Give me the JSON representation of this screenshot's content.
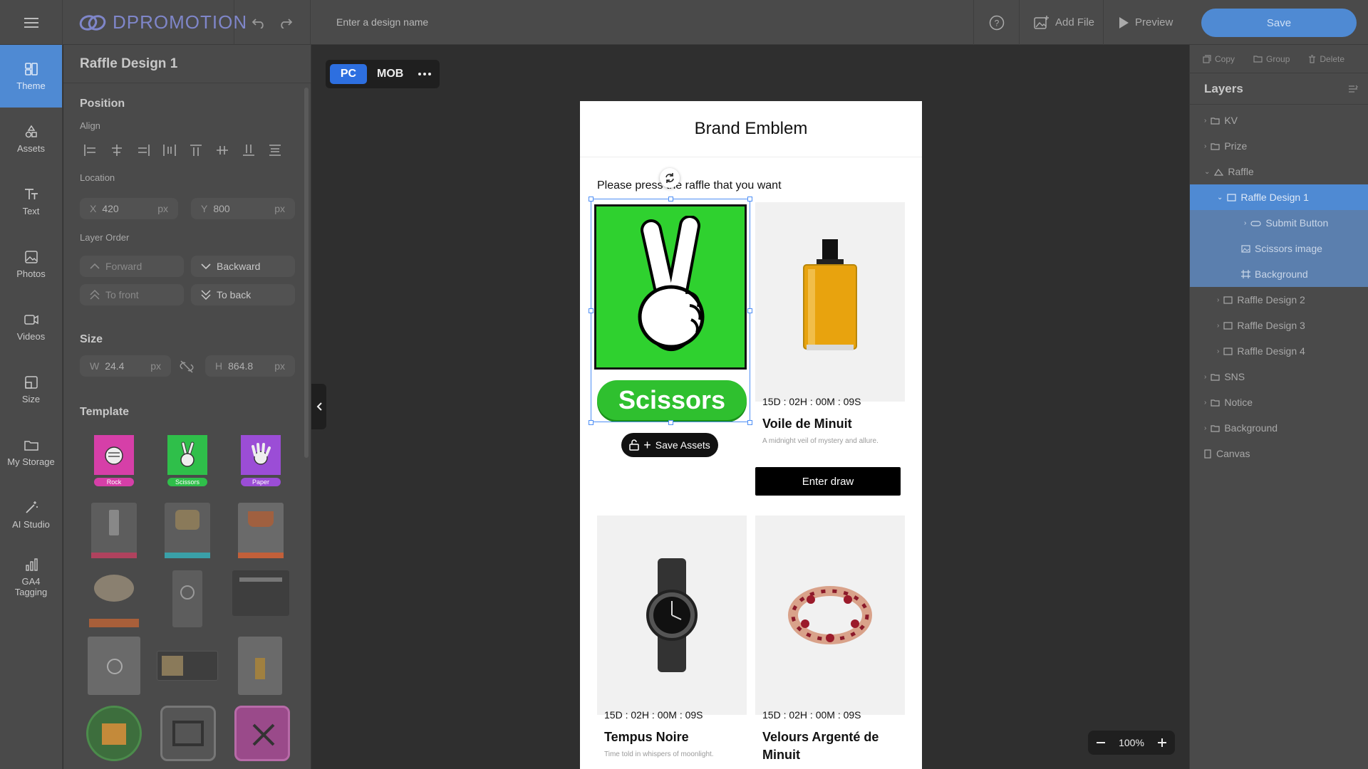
{
  "app": {
    "logo": "DPROMOTION"
  },
  "topbar": {
    "design_name_placeholder": "Enter a design name",
    "add_file": "Add File",
    "preview": "Preview",
    "save": "Save"
  },
  "nav": [
    {
      "label": "Theme",
      "icon": "theme-icon"
    },
    {
      "label": "Assets",
      "icon": "shapes-icon"
    },
    {
      "label": "Text",
      "icon": "text-icon"
    },
    {
      "label": "Photos",
      "icon": "photo-icon"
    },
    {
      "label": "Videos",
      "icon": "video-icon"
    },
    {
      "label": "Size",
      "icon": "resize-icon"
    },
    {
      "label": "My Storage",
      "icon": "folder-icon"
    },
    {
      "label": "AI Studio",
      "icon": "magic-wand-icon"
    },
    {
      "label": "GA4 Tagging",
      "icon": "bar-chart-icon"
    }
  ],
  "panel": {
    "title": "Raffle Design 1",
    "position": "Position",
    "align": "Align",
    "location": "Location",
    "x_label": "X",
    "x_value": "420",
    "y_label": "Y",
    "y_value": "800",
    "unit": "px",
    "layer_order": "Layer Order",
    "forward": "Forward",
    "backward": "Backward",
    "to_front": "To front",
    "to_back": "To back",
    "size": "Size",
    "w_label": "W",
    "w_value": "24.4",
    "h_label": "H",
    "h_value": "864.8",
    "template": "Template",
    "templates": [
      {
        "caption": "Rock",
        "color": "#d63fa8"
      },
      {
        "caption": "Scissors",
        "color": "#2fbf4a"
      },
      {
        "caption": "Paper",
        "color": "#9b4dd6"
      }
    ]
  },
  "canvas": {
    "pc": "PC",
    "mob": "MOB",
    "brand": "Brand Emblem",
    "instruction": "Please press the raffle that you want",
    "scissors_button": "Scissors",
    "save_assets": "Save Assets",
    "products": [
      {
        "timer": "15D : 02H : 00M : 09S",
        "name": "Voile de Minuit",
        "desc": "A midnight veil of mystery and allure."
      },
      {
        "timer": "15D : 02H : 00M : 09S",
        "name": "Tempus Noire",
        "desc": "Time told in whispers of moonlight."
      },
      {
        "timer": "15D : 02H : 00M : 09S",
        "name": "Velours Argenté de Minuit",
        "desc": ""
      }
    ],
    "enter_draw": "Enter draw",
    "zoom": "100%"
  },
  "right": {
    "copy": "Copy",
    "group": "Group",
    "delete": "Delete",
    "layers": "Layers",
    "items": [
      {
        "label": "KV"
      },
      {
        "label": "Prize"
      },
      {
        "label": "Raffle"
      },
      {
        "label": "Raffle Design 1"
      },
      {
        "label": "Submit Button"
      },
      {
        "label": "Scissors image"
      },
      {
        "label": "Background"
      },
      {
        "label": "Raffle Design 2"
      },
      {
        "label": "Raffle Design 3"
      },
      {
        "label": "Raffle Design 4"
      },
      {
        "label": "SNS"
      },
      {
        "label": "Notice"
      },
      {
        "label": "Background"
      },
      {
        "label": "Canvas"
      }
    ]
  },
  "colors": {
    "accent": "#4f8ad3",
    "pc_active": "#2d6fe0",
    "green": "#2fd12f",
    "selection": "#4d8ef5"
  }
}
